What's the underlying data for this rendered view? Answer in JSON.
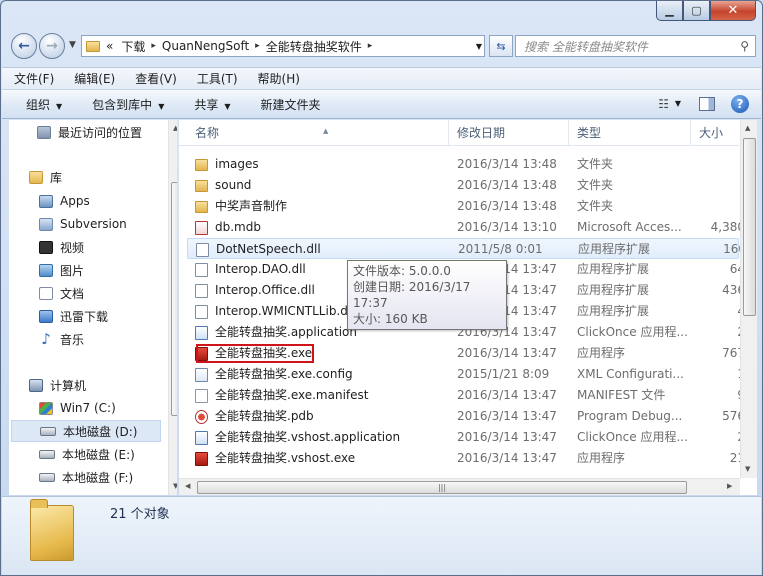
{
  "address": {
    "prefix": "«",
    "crumbs": [
      "下载",
      "QuanNengSoft",
      "全能转盘抽奖软件"
    ],
    "search_placeholder": "搜索 全能转盘抽奖软件"
  },
  "menu": [
    "文件(F)",
    "编辑(E)",
    "查看(V)",
    "工具(T)",
    "帮助(H)"
  ],
  "commands": {
    "organize": "组织",
    "include": "包含到库中",
    "share": "共享",
    "new_folder": "新建文件夹"
  },
  "nav": {
    "recent": "最近访问的位置",
    "library": "库",
    "apps": "Apps",
    "subversion": "Subversion",
    "video": "视频",
    "pictures": "图片",
    "documents": "文档",
    "xunlei": "迅雷下载",
    "music": "音乐",
    "computer": "计算机",
    "drive_c": "Win7 (C:)",
    "drive_d": "本地磁盘 (D:)",
    "drive_e": "本地磁盘 (E:)",
    "drive_f": "本地磁盘 (F:)"
  },
  "columns": {
    "name": "名称",
    "date": "修改日期",
    "type": "类型",
    "size": "大小"
  },
  "files": [
    {
      "name": "images",
      "date": "2016/3/14 13:48",
      "type": "文件夹",
      "size": "",
      "icon": "folder-icon"
    },
    {
      "name": "sound",
      "date": "2016/3/14 13:48",
      "type": "文件夹",
      "size": "",
      "icon": "folder-icon"
    },
    {
      "name": "中奖声音制作",
      "date": "2016/3/14 13:48",
      "type": "文件夹",
      "size": "",
      "icon": "folder-icon"
    },
    {
      "name": "db.mdb",
      "date": "2016/3/14 13:10",
      "type": "Microsoft Acces...",
      "size": "4,380",
      "icon": "access-db-icon"
    },
    {
      "name": "DotNetSpeech.dll",
      "date": "2011/5/8 0:01",
      "type": "应用程序扩展",
      "size": "160",
      "icon": "dll-icon"
    },
    {
      "name": "Interop.DAO.dll",
      "date": "2016/3/14 13:47",
      "type": "应用程序扩展",
      "size": "64",
      "icon": "dll-icon"
    },
    {
      "name": "Interop.Office.dll",
      "date": "2016/3/14 13:47",
      "type": "应用程序扩展",
      "size": "436",
      "icon": "dll-icon"
    },
    {
      "name": "Interop.WMICNTLLib.dll",
      "date": "2016/3/14 13:47",
      "type": "应用程序扩展",
      "size": "4",
      "icon": "dll-icon"
    },
    {
      "name": "全能转盘抽奖.application",
      "date": "2016/3/14 13:47",
      "type": "ClickOnce 应用程...",
      "size": "2",
      "icon": "clickonce-icon"
    },
    {
      "name": "全能转盘抽奖.exe",
      "date": "2016/3/14 13:47",
      "type": "应用程序",
      "size": "767",
      "icon": "exe-icon"
    },
    {
      "name": "全能转盘抽奖.exe.config",
      "date": "2015/1/21 8:09",
      "type": "XML Configurati...",
      "size": "1",
      "icon": "config-icon"
    },
    {
      "name": "全能转盘抽奖.exe.manifest",
      "date": "2016/3/14 13:47",
      "type": "MANIFEST 文件",
      "size": "9",
      "icon": "manifest-icon"
    },
    {
      "name": "全能转盘抽奖.pdb",
      "date": "2016/3/14 13:47",
      "type": "Program Debug...",
      "size": "576",
      "icon": "pdb-icon"
    },
    {
      "name": "全能转盘抽奖.vshost.application",
      "date": "2016/3/14 13:47",
      "type": "ClickOnce 应用程...",
      "size": "2",
      "icon": "clickonce-icon"
    },
    {
      "name": "全能转盘抽奖.vshost.exe",
      "date": "2016/3/14 13:47",
      "type": "应用程序",
      "size": "21",
      "icon": "exe-icon"
    }
  ],
  "tooltip": {
    "version": "文件版本: 5.0.0.0",
    "created": "创建日期: 2016/3/17 17:37",
    "size": "大小: 160 KB"
  },
  "status": {
    "count": "21 个对象"
  }
}
